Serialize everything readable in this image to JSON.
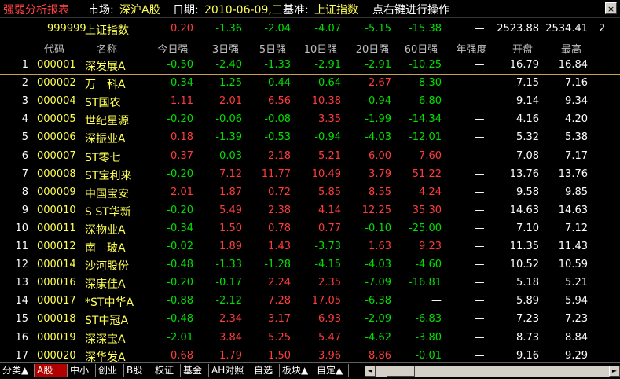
{
  "colors": {
    "up": "#ff3c3c",
    "down": "#00e000",
    "flat": "#ffffff",
    "yellow": "#ffff54",
    "cyan": "#54ffff",
    "red": "#ff4040"
  },
  "titlebar": {
    "title": "强弱分析报表",
    "market_label": "市场:",
    "market_value": "深沪A股",
    "date_label": "日期:",
    "date_value": "2010-06-09,三",
    "base_label": "基准:",
    "base_value": "上证指数",
    "hint": "点右键进行操作",
    "close_glyph": "×"
  },
  "index_row": {
    "code": "999999",
    "name": "上证指数",
    "values": [
      "0.20",
      "-1.36",
      "-2.04",
      "-4.07",
      "-5.15",
      "-15.38"
    ],
    "year": "—",
    "open": "2523.88",
    "high": "2534.41",
    "extra": "2"
  },
  "columns": [
    "代码",
    "名称",
    "今日强",
    "3日强",
    "5日强",
    "10日强",
    "20日强",
    "60日强",
    "年强度",
    "开盘",
    "最高"
  ],
  "rows": [
    {
      "n": "1",
      "code": "000001",
      "name": "深发展A",
      "v": [
        "-0.50",
        "-2.40",
        "-1.33",
        "-2.91",
        "-2.91",
        "-10.25"
      ],
      "year": "—",
      "open": "16.79",
      "high": "16.84"
    },
    {
      "n": "2",
      "code": "000002",
      "name": "万　科A",
      "v": [
        "-0.34",
        "-1.25",
        "-0.44",
        "-0.64",
        "2.67",
        "-8.30"
      ],
      "year": "—",
      "open": "7.15",
      "high": "7.16"
    },
    {
      "n": "3",
      "code": "000004",
      "name": "ST国农",
      "v": [
        "1.11",
        "2.01",
        "6.56",
        "10.38",
        "-0.94",
        "-6.80"
      ],
      "year": "—",
      "open": "9.14",
      "high": "9.34"
    },
    {
      "n": "4",
      "code": "000005",
      "name": "世纪星源",
      "v": [
        "-0.20",
        "-0.06",
        "-0.08",
        "3.35",
        "-1.99",
        "-14.34"
      ],
      "year": "—",
      "open": "4.16",
      "high": "4.20"
    },
    {
      "n": "5",
      "code": "000006",
      "name": "深振业A",
      "v": [
        "0.18",
        "-1.39",
        "-0.53",
        "-0.94",
        "-4.03",
        "-12.01"
      ],
      "year": "—",
      "open": "5.32",
      "high": "5.38"
    },
    {
      "n": "6",
      "code": "000007",
      "name": "ST零七",
      "v": [
        "0.37",
        "-0.03",
        "2.18",
        "5.21",
        "6.00",
        "7.60"
      ],
      "year": "—",
      "open": "7.08",
      "high": "7.17"
    },
    {
      "n": "7",
      "code": "000008",
      "name": "ST宝利来",
      "v": [
        "-0.20",
        "7.12",
        "11.77",
        "10.49",
        "3.79",
        "51.22"
      ],
      "year": "—",
      "open": "13.76",
      "high": "13.76"
    },
    {
      "n": "8",
      "code": "000009",
      "name": "中国宝安",
      "v": [
        "2.01",
        "1.87",
        "0.72",
        "5.85",
        "8.55",
        "4.24"
      ],
      "year": "—",
      "open": "9.58",
      "high": "9.85"
    },
    {
      "n": "9",
      "code": "000010",
      "name": "S ST华新",
      "v": [
        "-0.20",
        "5.49",
        "2.38",
        "4.14",
        "12.25",
        "35.30"
      ],
      "year": "—",
      "open": "14.63",
      "high": "14.63"
    },
    {
      "n": "10",
      "code": "000011",
      "name": "深物业A",
      "v": [
        "-0.34",
        "1.50",
        "0.78",
        "0.77",
        "-0.10",
        "-25.00"
      ],
      "year": "—",
      "open": "7.10",
      "high": "7.12"
    },
    {
      "n": "11",
      "code": "000012",
      "name": "南　玻A",
      "v": [
        "-0.02",
        "1.89",
        "1.43",
        "-3.73",
        "1.63",
        "9.23"
      ],
      "year": "—",
      "open": "11.35",
      "high": "11.43"
    },
    {
      "n": "12",
      "code": "000014",
      "name": "沙河股份",
      "v": [
        "-0.48",
        "-1.33",
        "-1.28",
        "-4.15",
        "-4.03",
        "-4.60"
      ],
      "year": "—",
      "open": "10.52",
      "high": "10.59"
    },
    {
      "n": "13",
      "code": "000016",
      "name": "深康佳A",
      "v": [
        "-0.20",
        "-0.17",
        "2.24",
        "2.35",
        "-7.09",
        "-16.81"
      ],
      "year": "—",
      "open": "5.18",
      "high": "5.21"
    },
    {
      "n": "14",
      "code": "000017",
      "name": "*ST中华A",
      "v": [
        "-0.88",
        "-2.12",
        "7.28",
        "17.05",
        "-6.38",
        "—"
      ],
      "year": "—",
      "open": "5.89",
      "high": "5.94"
    },
    {
      "n": "15",
      "code": "000018",
      "name": "ST中冠A",
      "v": [
        "-0.48",
        "2.34",
        "3.17",
        "6.93",
        "-2.09",
        "-6.83"
      ],
      "year": "—",
      "open": "7.23",
      "high": "7.23"
    },
    {
      "n": "16",
      "code": "000019",
      "name": "深深宝A",
      "v": [
        "-2.01",
        "3.84",
        "5.25",
        "5.47",
        "-4.62",
        "-3.80"
      ],
      "year": "—",
      "open": "8.73",
      "high": "8.84"
    },
    {
      "n": "17",
      "code": "000020",
      "name": "深华发A",
      "v": [
        "0.68",
        "1.79",
        "1.50",
        "3.96",
        "8.86",
        "-0.01"
      ],
      "year": "—",
      "open": "9.16",
      "high": "9.29"
    }
  ],
  "tabs": [
    "分类▲",
    "A股",
    "中小",
    "创业",
    "B股",
    "权证",
    "基金",
    "AH对照",
    "自选",
    "板块▲",
    "自定▲"
  ],
  "active_tab": 1,
  "scroll": {
    "left": "◄",
    "right": "►"
  }
}
